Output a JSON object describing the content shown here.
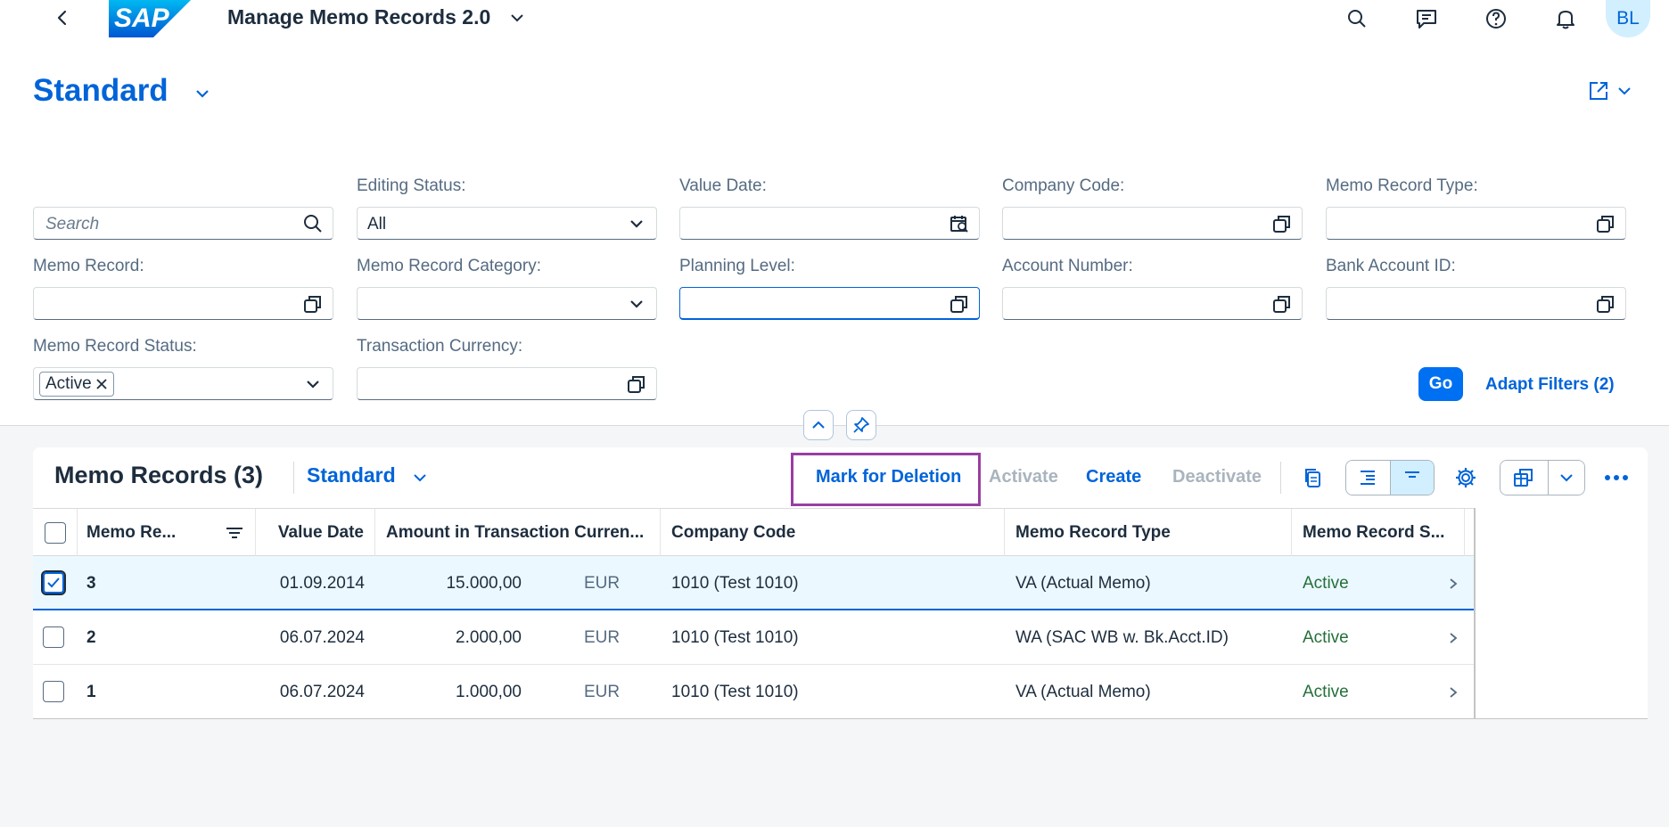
{
  "shell": {
    "title": "Manage Memo Records 2.0",
    "avatar_initials": "BL",
    "logo_text": "SAP"
  },
  "header": {
    "variant": "Standard"
  },
  "filters": {
    "search_placeholder": "Search",
    "editing_status_label": "Editing Status:",
    "editing_status_value": "All",
    "value_date_label": "Value Date:",
    "company_code_label": "Company Code:",
    "memo_record_type_label": "Memo Record Type:",
    "memo_record_label": "Memo Record:",
    "memo_record_category_label": "Memo Record Category:",
    "planning_level_label": "Planning Level:",
    "account_number_label": "Account Number:",
    "bank_account_id_label": "Bank Account ID:",
    "memo_record_status_label": "Memo Record Status:",
    "memo_record_status_token": "Active",
    "transaction_currency_label": "Transaction Currency:",
    "go_label": "Go",
    "adapt_filters_label": "Adapt Filters (2)"
  },
  "table": {
    "title": "Memo Records (3)",
    "variant": "Standard",
    "toolbar": {
      "mark_for_deletion": "Mark for Deletion",
      "activate": "Activate",
      "create": "Create",
      "deactivate": "Deactivate"
    },
    "columns": {
      "memo_record": "Memo Re...",
      "value_date": "Value Date",
      "amount": "Amount in Transaction Curren...",
      "company_code": "Company Code",
      "memo_record_type": "Memo Record Type",
      "memo_record_status": "Memo Record S..."
    },
    "rows": [
      {
        "selected": true,
        "memo_record": "3",
        "value_date": "01.09.2014",
        "amount": "15.000,00",
        "currency": "EUR",
        "company_code": "1010 (Test 1010)",
        "type": "VA (Actual Memo)",
        "status": "Active"
      },
      {
        "selected": false,
        "memo_record": "2",
        "value_date": "06.07.2024",
        "amount": "2.000,00",
        "currency": "EUR",
        "company_code": "1010 (Test 1010)",
        "type": "WA (SAC WB w. Bk.Acct.ID)",
        "status": "Active"
      },
      {
        "selected": false,
        "memo_record": "1",
        "value_date": "06.07.2024",
        "amount": "1.000,00",
        "currency": "EUR",
        "company_code": "1010 (Test 1010)",
        "type": "VA (Actual Memo)",
        "status": "Active"
      }
    ]
  },
  "colors": {
    "accent": "#0064d9",
    "status_positive": "#256f3a",
    "highlight_box": "#9a3ea3"
  }
}
